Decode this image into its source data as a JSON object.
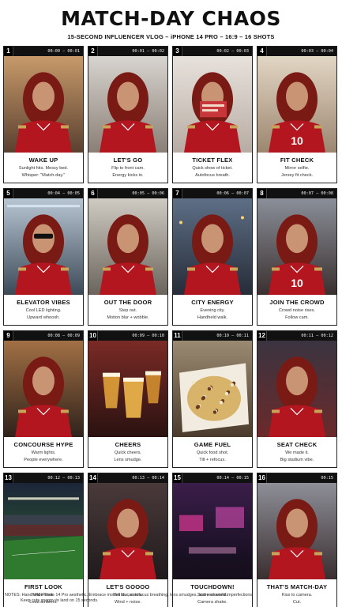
{
  "header": {
    "title": "MATCH-DAY CHAOS",
    "subtitle": "15-SECOND INFLUENCER VLOG – iPHONE 14 PRO – 16:9 – 16 SHOTS"
  },
  "panels": [
    {
      "num": "1",
      "time": "00:00 – 00:01",
      "title": "WAKE UP",
      "line1": "Sunlight hits. Messy bed.",
      "line2": "Whisper: \"Match-day.\"",
      "scene": "bedroom",
      "bg1": "#c79a6a",
      "bg2": "#5a4030"
    },
    {
      "num": "2",
      "time": "00:01 – 00:02",
      "title": "LET'S GO",
      "line1": "Flip to front cam.",
      "line2": "Energy kicks in.",
      "scene": "room",
      "bg1": "#d8d4cf",
      "bg2": "#8a7f76"
    },
    {
      "num": "3",
      "time": "00:02 – 00:03",
      "title": "TICKET FLEX",
      "line1": "Quick show of ticket.",
      "line2": "Autofocus breath.",
      "scene": "ticket",
      "bg1": "#e8e2dc",
      "bg2": "#b7aca4"
    },
    {
      "num": "4",
      "time": "00:03 – 00:04",
      "title": "FIT CHECK",
      "line1": "Mirror selfie.",
      "line2": "Jersey fit check.",
      "scene": "mirror",
      "bg1": "#e2d6c4",
      "bg2": "#9c8670"
    },
    {
      "num": "5",
      "time": "00:04 – 00:05",
      "title": "ELEVATOR VIBES",
      "line1": "Cool LED lighting.",
      "line2": "Upward whoosh.",
      "scene": "elevator",
      "bg1": "#b8c6d3",
      "bg2": "#3c4a58"
    },
    {
      "num": "6",
      "time": "00:05 – 00:06",
      "title": "OUT THE DOOR",
      "line1": "Step out.",
      "line2": "Motion blur + wobble.",
      "scene": "door",
      "bg1": "#cfcac2",
      "bg2": "#6a645c"
    },
    {
      "num": "7",
      "time": "00:06 – 00:07",
      "title": "CITY ENERGY",
      "line1": "Evening city.",
      "line2": "Handheld walk.",
      "scene": "city",
      "bg1": "#5e6f86",
      "bg2": "#262c38"
    },
    {
      "num": "8",
      "time": "00:07 – 00:08",
      "title": "JOIN THE CROWD",
      "line1": "Crowd noise rises.",
      "line2": "Follow cam.",
      "scene": "crowd",
      "bg1": "#8a8f99",
      "bg2": "#3b3030"
    },
    {
      "num": "9",
      "time": "00:08 – 00:09",
      "title": "CONCOURSE HYPE",
      "line1": "Warm lights.",
      "line2": "People everywhere.",
      "scene": "concourse",
      "bg1": "#a27045",
      "bg2": "#2f221a"
    },
    {
      "num": "10",
      "time": "00:09 – 00:10",
      "title": "CHEERS",
      "line1": "Quick cheers.",
      "line2": "Lens smudge.",
      "scene": "cheers",
      "bg1": "#7a2a26",
      "bg2": "#2a1210"
    },
    {
      "num": "11",
      "time": "00:10 – 00:11",
      "title": "GAME FUEL",
      "line1": "Quick food shot.",
      "line2": "Tilt + refocus.",
      "scene": "food",
      "bg1": "#9b8a72",
      "bg2": "#4a3b2c"
    },
    {
      "num": "12",
      "time": "00:11 – 00:12",
      "title": "SEAT CHECK",
      "line1": "We made it.",
      "line2": "Big stadium vibe.",
      "scene": "seat",
      "bg1": "#3a3440",
      "bg2": "#6b2a2a"
    },
    {
      "num": "13",
      "time": "00:12 – 00:13",
      "title": "FIRST LOOK",
      "line1": "Wide shot.",
      "line2": "Loud ambient.",
      "scene": "field",
      "bg1": "#1c2538",
      "bg2": "#2f6a2e"
    },
    {
      "num": "14",
      "time": "00:13 – 00:14",
      "title": "LET'S GOOOO",
      "line1": "Yell to camera.",
      "line2": "Wind + noise.",
      "scene": "yell",
      "bg1": "#4a3a3a",
      "bg2": "#1f1a1c"
    },
    {
      "num": "15",
      "time": "00:14 – 00:15",
      "title": "TOUCHDOWN!",
      "line1": "Score moment.",
      "line2": "Camera shake.",
      "scene": "blur",
      "bg1": "#3b1e4a",
      "bg2": "#0f0b18"
    },
    {
      "num": "16",
      "time": "00:15",
      "title": "THAT'S MATCH-DAY",
      "line1": "Kiss to camera.",
      "line2": "Cut.",
      "scene": "kiss",
      "bg1": "#8e8f98",
      "bg2": "#3a2e30"
    }
  ],
  "notes": {
    "line1": "NOTES: Handheld iPhone 14 Pro aesthetic. Embrace motion blur, autofocus breathing, lens smudges, and real-world imperfections.",
    "line2": "Keep cuts snappy to land on 15 seconds."
  },
  "colors": {
    "hair": "#7a1a14",
    "jersey": "#b3161f",
    "skin": "#c99474",
    "gold": "#c8a45a"
  }
}
